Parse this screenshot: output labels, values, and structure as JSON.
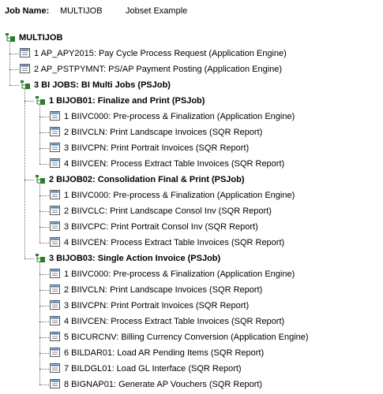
{
  "header": {
    "label": "Job Name:",
    "job_name": "MULTIJOB",
    "description": "Jobset Example"
  },
  "tree": [
    {
      "level": 0,
      "type": "job",
      "text": "MULTIJOB",
      "bold": true
    },
    {
      "level": 1,
      "type": "process",
      "text": "1 AP_APY2015: Pay Cycle Process Request (Application Engine)"
    },
    {
      "level": 1,
      "type": "process",
      "text": "2 AP_PSTPYMNT: PS/AP Payment Posting (Application Engine)"
    },
    {
      "level": 1,
      "type": "job",
      "text": "3 BI JOBS: BI Multi Jobs (PSJob)",
      "bold": true
    },
    {
      "level": 2,
      "type": "job",
      "text": "1 BIJOB01: Finalize and Print (PSJob)",
      "bold": true
    },
    {
      "level": 3,
      "type": "process",
      "text": "1 BIIVC000: Pre-process & Finalization (Application Engine)"
    },
    {
      "level": 3,
      "type": "process",
      "text": "2 BIIVCLN: Print Landscape Invoices (SQR Report)"
    },
    {
      "level": 3,
      "type": "process",
      "text": "3 BIIVCPN: Print Portrait Invoices (SQR Report)"
    },
    {
      "level": 3,
      "type": "process",
      "text": "4 BIIVCEN: Process Extract Table Invoices (SQR Report)"
    },
    {
      "level": 2,
      "type": "job",
      "text": "2 BIJOB02: Consolidation Final & Print (PSJob)",
      "bold": true
    },
    {
      "level": 3,
      "type": "process",
      "text": "1 BIIVC000: Pre-process & Finalization (Application Engine)"
    },
    {
      "level": 3,
      "type": "process",
      "text": "2 BIIVCLC: Print Landscape Consol Inv (SQR Report)"
    },
    {
      "level": 3,
      "type": "process",
      "text": "3 BIIVCPC: Print Portrait Consol Inv (SQR Report)"
    },
    {
      "level": 3,
      "type": "process",
      "text": "4 BIIVCEN: Process Extract Table Invoices (SQR Report)"
    },
    {
      "level": 2,
      "type": "job",
      "text": "3 BIJOB03: Single Action Invoice (PSJob)",
      "bold": true
    },
    {
      "level": 3,
      "type": "process",
      "text": "1 BIIVC000: Pre-process & Finalization (Application Engine)"
    },
    {
      "level": 3,
      "type": "process",
      "text": "2 BIIVCLN: Print Landscape Invoices (SQR Report)"
    },
    {
      "level": 3,
      "type": "process",
      "text": "3 BIIVCPN: Print Portrait Invoices (SQR Report)"
    },
    {
      "level": 3,
      "type": "process",
      "text": "4 BIIVCEN: Process Extract Table Invoices (SQR Report)"
    },
    {
      "level": 3,
      "type": "process",
      "text": "5 BICURCNV: Billing Currency Conversion (Application Engine)"
    },
    {
      "level": 3,
      "type": "process",
      "text": "6 BILDAR01: Load AR Pending Items (SQR Report)"
    },
    {
      "level": 3,
      "type": "process",
      "text": "7 BILDGL01: Load GL Interface (SQR Report)"
    },
    {
      "level": 3,
      "type": "process",
      "text": "8 BIGNAP01: Generate AP Vouchers (SQR Report)"
    }
  ],
  "icons": {
    "job": "job-tree-icon",
    "process": "process-icon"
  },
  "colors": {
    "job_icon": "#2a7d2a",
    "process_icon": "#3a6fb0",
    "tree_lines": "#6b6b6b"
  }
}
